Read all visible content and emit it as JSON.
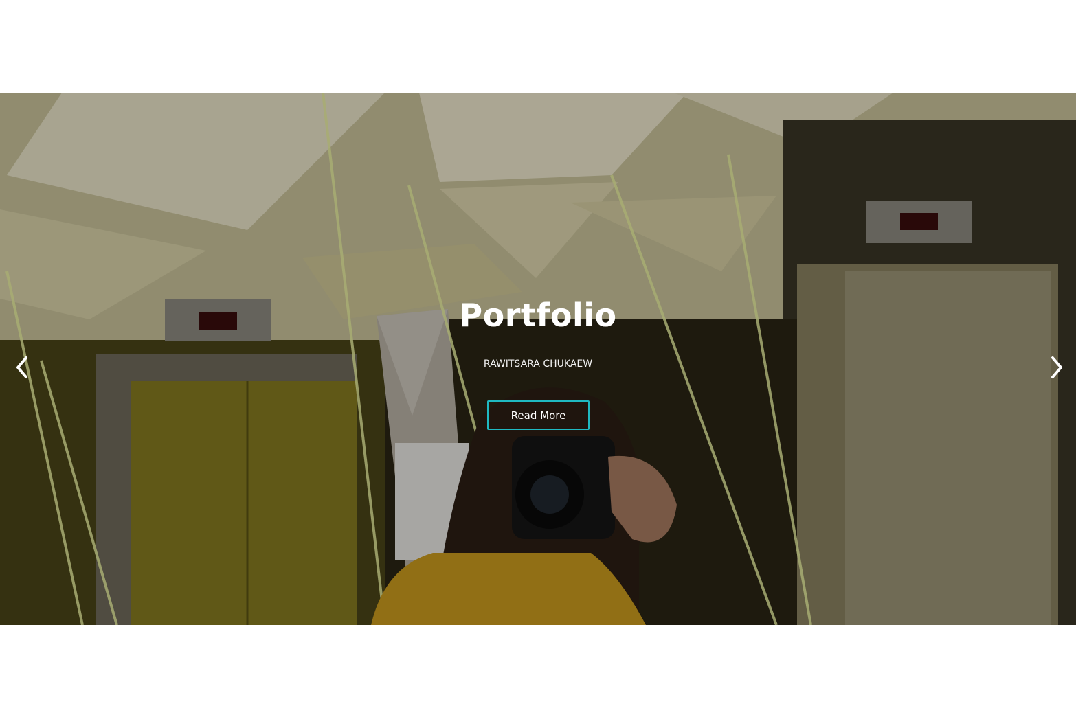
{
  "hero": {
    "title": "Portfolio",
    "subtitle": "RAWITSARA CHUKAEW",
    "button_label": "Read More",
    "accent_color": "#1fb9c2",
    "background_image": "photographer-selfie-in-elevator-lobby",
    "prev_icon": "chevron-left-icon",
    "next_icon": "chevron-right-icon"
  }
}
